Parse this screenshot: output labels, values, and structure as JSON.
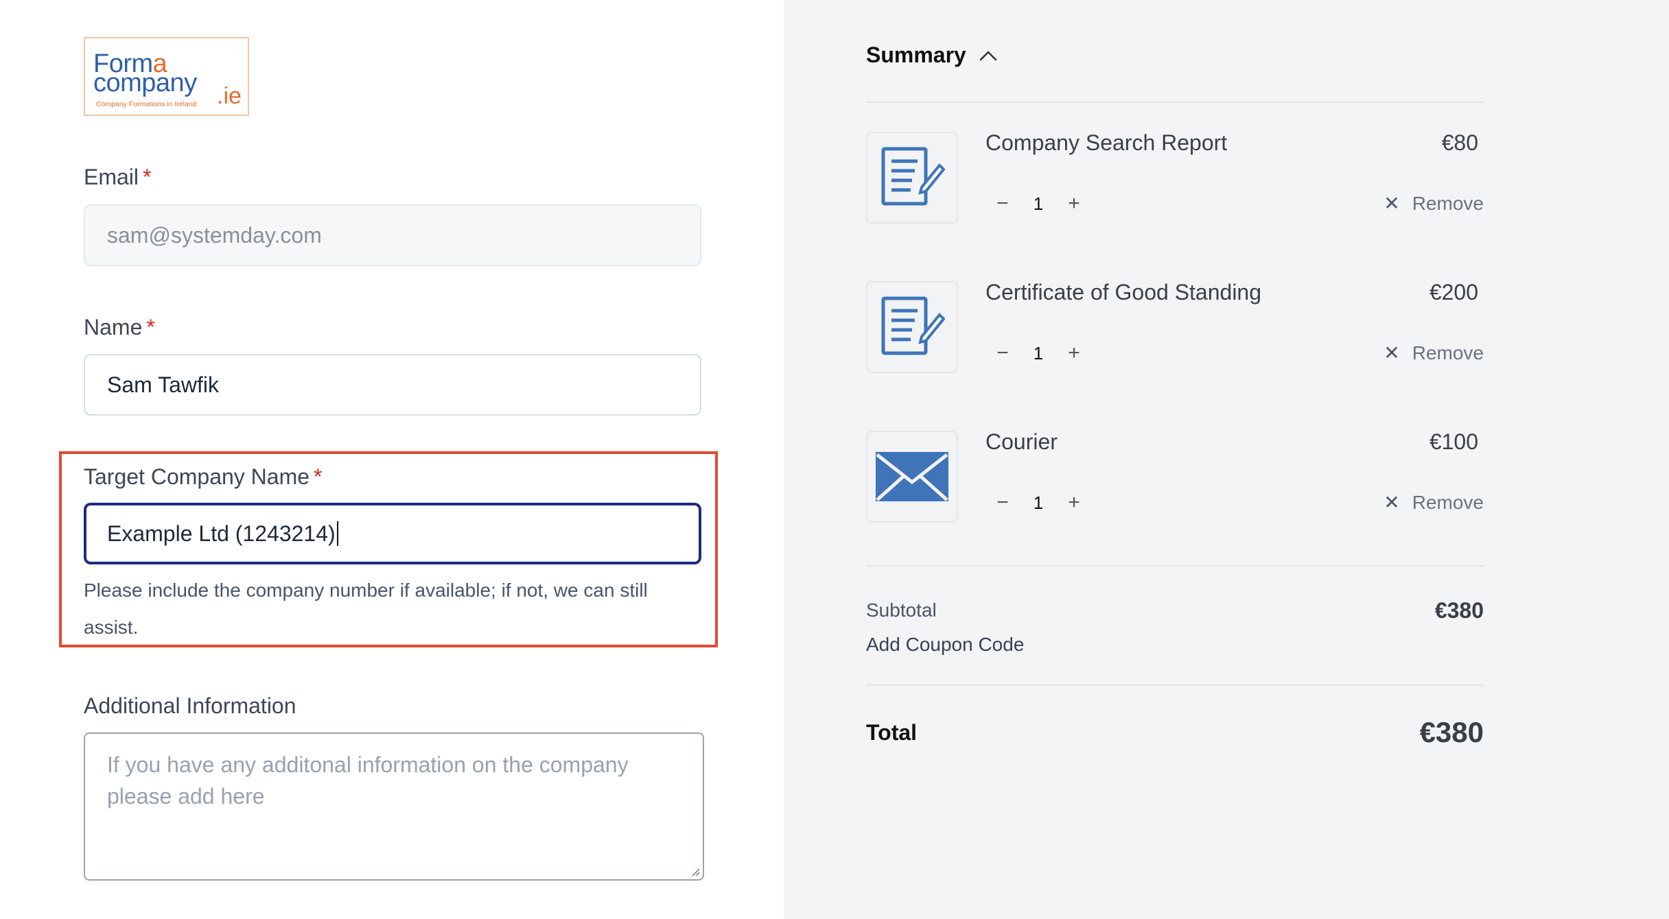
{
  "logo": {
    "line1_a": "Form",
    "line1_b": "a",
    "line2": "company",
    "suffix": ".ie",
    "tagline": "Company Formations in Ireland"
  },
  "form": {
    "email": {
      "label": "Email",
      "required_mark": "*",
      "value": "sam@systemday.com"
    },
    "name": {
      "label": "Name",
      "required_mark": "*",
      "value": "Sam Tawfik"
    },
    "target_company": {
      "label": "Target Company Name",
      "required_mark": "*",
      "value": "Example Ltd (1243214)",
      "helper": "Please include the company number if available; if not, we can still assist."
    },
    "additional_info": {
      "label": "Additional Information",
      "placeholder": "If you have any additonal information on the company please add here"
    }
  },
  "summary": {
    "title": "Summary",
    "items": [
      {
        "name": "Company Search Report",
        "price": "€80",
        "quantity": "1",
        "icon": "document-edit-icon",
        "remove_label": "Remove"
      },
      {
        "name": "Certificate of Good Standing",
        "price": "€200",
        "quantity": "1",
        "icon": "document-edit-icon",
        "remove_label": "Remove"
      },
      {
        "name": "Courier",
        "price": "€100",
        "quantity": "1",
        "icon": "envelope-icon",
        "remove_label": "Remove"
      }
    ],
    "qty_minus": "−",
    "qty_plus": "+",
    "subtotal_label": "Subtotal",
    "subtotal_value": "€380",
    "coupon_label": "Add Coupon Code",
    "total_label": "Total",
    "total_value": "€380"
  },
  "colors": {
    "highlight_border": "#e34a33",
    "focus_border": "#1e2a80",
    "icon_blue": "#3f74b8",
    "logo_blue": "#2f5fa8",
    "logo_orange": "#e36d2c"
  }
}
